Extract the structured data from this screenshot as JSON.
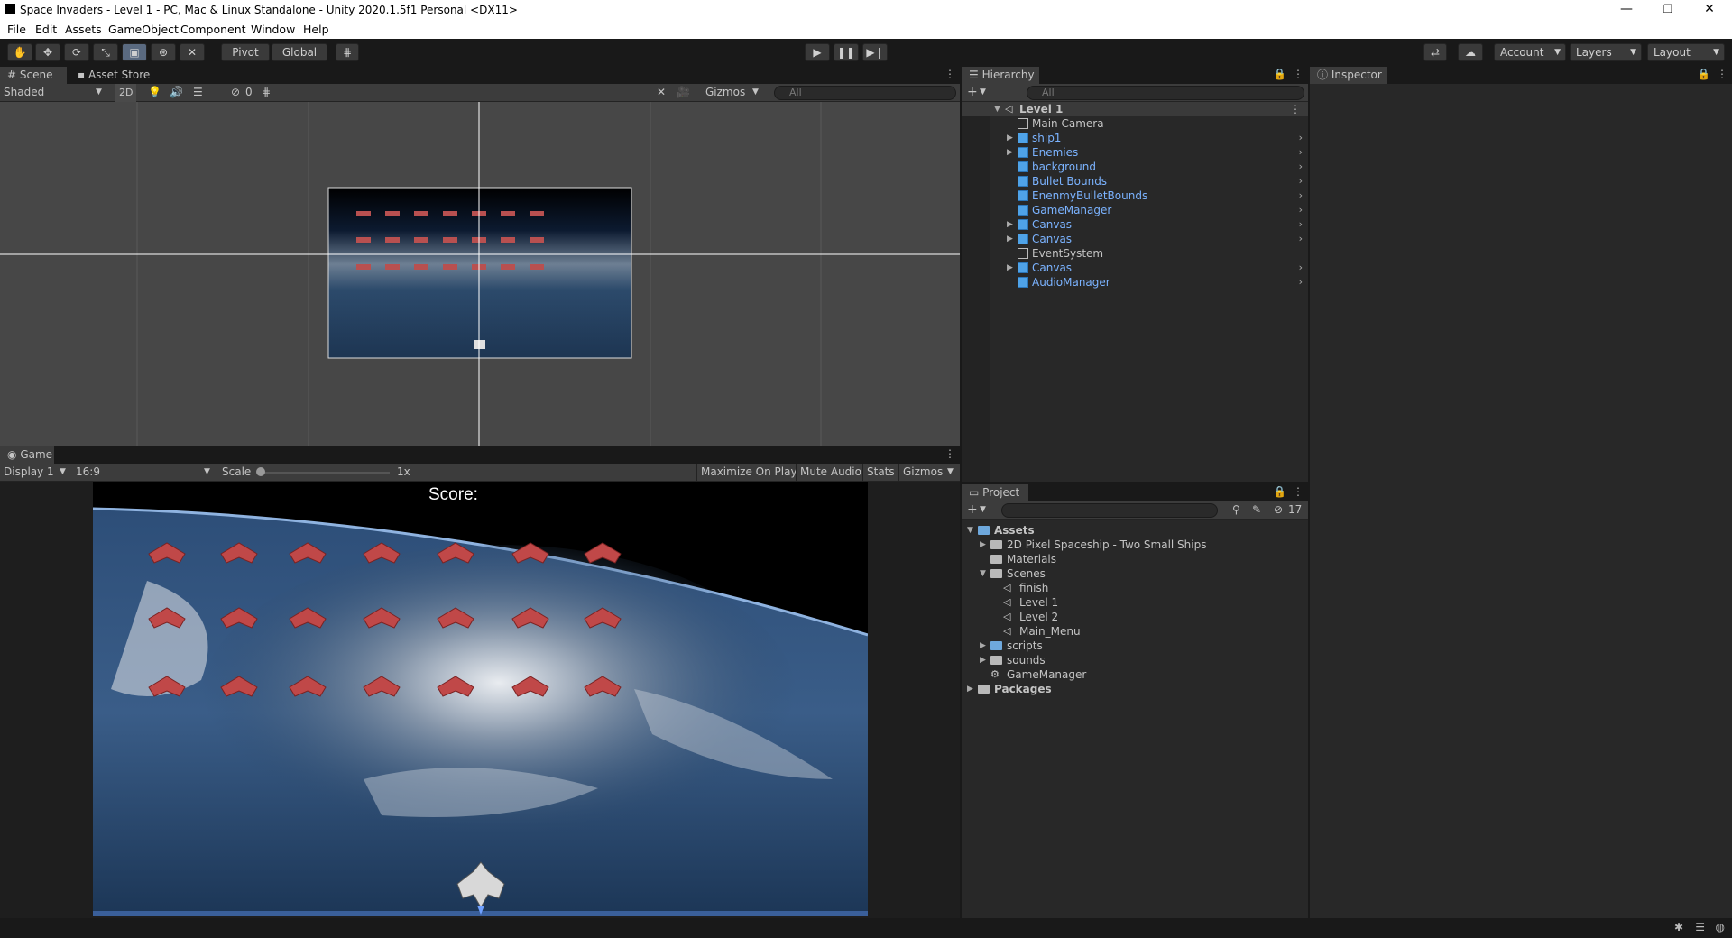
{
  "window": {
    "title": "Space Invaders - Level 1 - PC, Mac & Linux Standalone - Unity 2020.1.5f1 Personal <DX11>",
    "controls": {
      "minimize": "—",
      "restore": "❐",
      "close": "✕"
    }
  },
  "menu": [
    "File",
    "Edit",
    "Assets",
    "GameObject",
    "Component",
    "Window",
    "Help"
  ],
  "toolbar": {
    "pivot_label": "Pivot",
    "global_label": "Global",
    "account_label": "Account",
    "layers_label": "Layers",
    "layout_label": "Layout"
  },
  "scene": {
    "tabs": [
      "Scene",
      "Asset Store"
    ],
    "shading_mode": "Shaded",
    "toggle_2d": "2D",
    "hidden_count": "0",
    "gizmos_label": "Gizmos",
    "search_placeholder": "All"
  },
  "game": {
    "tab": "Game",
    "display": "Display 1",
    "aspect": "16:9",
    "scale_label": "Scale",
    "scale_value": "1x",
    "maximize_label": "Maximize On Play",
    "mute_label": "Mute Audio",
    "stats_label": "Stats",
    "gizmos_label": "Gizmos",
    "score_label": "Score:"
  },
  "hierarchy": {
    "tab": "Hierarchy",
    "search_placeholder": "All",
    "scene_name": "Level 1",
    "items": [
      {
        "name": "Main Camera",
        "prefab": false,
        "expandable": false
      },
      {
        "name": "ship1",
        "prefab": true,
        "expandable": true
      },
      {
        "name": "Enemies",
        "prefab": true,
        "expandable": true
      },
      {
        "name": "background",
        "prefab": true,
        "expandable": false
      },
      {
        "name": "Bullet Bounds",
        "prefab": true,
        "expandable": false
      },
      {
        "name": "EnenmyBulletBounds",
        "prefab": true,
        "expandable": false
      },
      {
        "name": "GameManager",
        "prefab": true,
        "expandable": false
      },
      {
        "name": "Canvas",
        "prefab": true,
        "expandable": true
      },
      {
        "name": "Canvas",
        "prefab": true,
        "expandable": true
      },
      {
        "name": "EventSystem",
        "prefab": false,
        "expandable": false
      },
      {
        "name": "Canvas",
        "prefab": true,
        "expandable": true
      },
      {
        "name": "AudioManager",
        "prefab": true,
        "expandable": false
      }
    ]
  },
  "inspector": {
    "tab": "Inspector"
  },
  "project": {
    "tab": "Project",
    "hidden_count": "17",
    "tree": [
      {
        "label": "Assets",
        "bold": true
      },
      {
        "label": "2D Pixel Spaceship - Two Small Ships",
        "bold": false
      },
      {
        "label": "Materials",
        "bold": false
      },
      {
        "label": "Scenes",
        "bold": false
      },
      {
        "label": "finish",
        "bold": false
      },
      {
        "label": "Level 1",
        "bold": false
      },
      {
        "label": "Level 2",
        "bold": false
      },
      {
        "label": "Main_Menu",
        "bold": false
      },
      {
        "label": "scripts",
        "bold": false
      },
      {
        "label": "sounds",
        "bold": false
      },
      {
        "label": "GameManager",
        "bold": false
      },
      {
        "label": "Packages",
        "bold": true
      }
    ]
  },
  "colors": {
    "editor_bg": "#282828",
    "toolbar_bg": "#191919",
    "prefab_blue": "#7bb3ff",
    "selection": "#3a3a3a"
  }
}
